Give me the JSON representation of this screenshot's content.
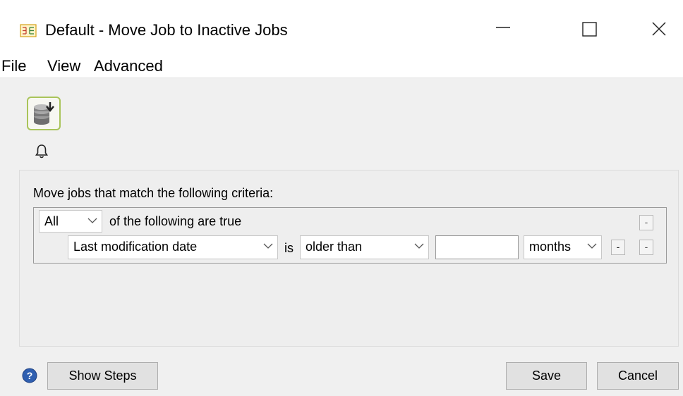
{
  "window": {
    "title": "Default - Move Job to Inactive Jobs",
    "icons": {
      "app": "app-flow-icon",
      "minimize": "minimize-icon",
      "maximize": "maximize-icon",
      "close": "close-icon"
    }
  },
  "menu": {
    "items": [
      {
        "label": "File"
      },
      {
        "label": "View"
      },
      {
        "label": "Advanced"
      }
    ]
  },
  "toolbar": {
    "action_icon": "database-download-icon",
    "bell_icon": "bell-icon",
    "accent_border": "#a9c45a"
  },
  "criteria": {
    "heading": "Move jobs that match the following criteria:",
    "group_match": {
      "selected": "All",
      "trailing_text": "of the following are true"
    },
    "rows": [
      {
        "field": "Last modification date",
        "connector": "is",
        "operator": "older than",
        "value": "",
        "unit": "months"
      }
    ],
    "remove_button_label": "-"
  },
  "footer": {
    "help_icon": "help-icon",
    "help_color": "#2f5fb0",
    "show_steps_label": "Show Steps",
    "save_label": "Save",
    "cancel_label": "Cancel"
  }
}
